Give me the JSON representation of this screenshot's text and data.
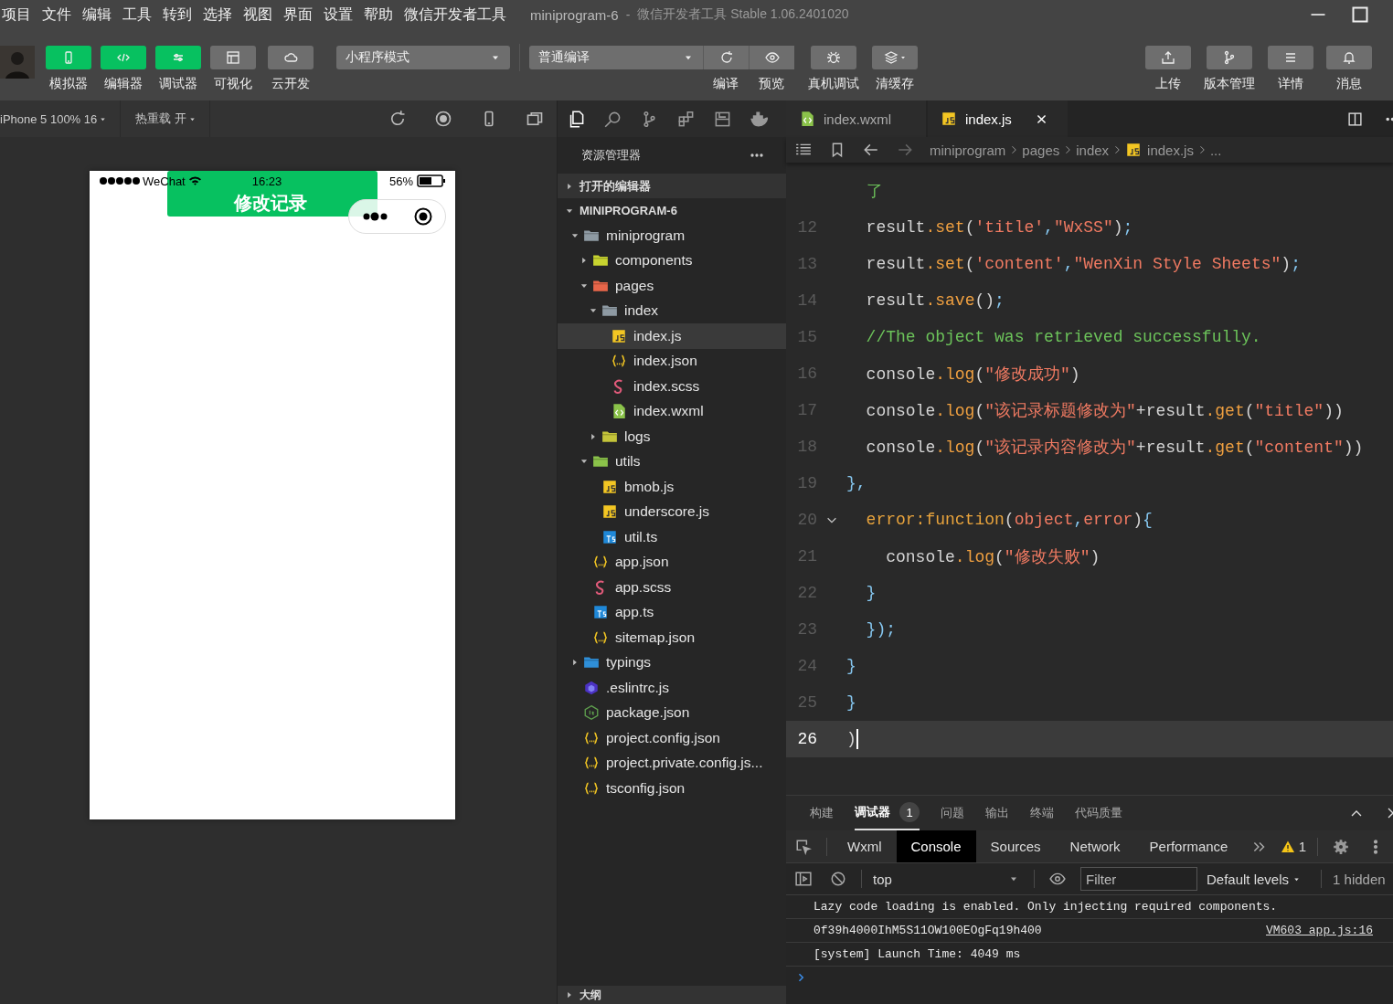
{
  "menu": [
    "项目",
    "文件",
    "编辑",
    "工具",
    "转到",
    "选择",
    "视图",
    "界面",
    "设置",
    "帮助",
    "微信开发者工具"
  ],
  "window": {
    "title": "miniprogram-6",
    "separator": "-",
    "subtitle": "微信开发者工具 Stable 1.06.2401020"
  },
  "toolbar": {
    "left_buttons": [
      {
        "label": "模拟器",
        "kind": "phone",
        "on": true
      },
      {
        "label": "编辑器",
        "kind": "code",
        "on": true
      },
      {
        "label": "调试器",
        "kind": "sliders",
        "on": true
      },
      {
        "label": "可视化",
        "kind": "layout",
        "on": false
      },
      {
        "label": "云开发",
        "kind": "cloud",
        "on": false
      }
    ],
    "mode_select": {
      "value": "小程序模式"
    },
    "compile_select": {
      "value": "普通编译"
    },
    "actions": [
      {
        "label": "编译",
        "kind": "refresh"
      },
      {
        "label": "预览",
        "kind": "eye"
      },
      {
        "label": "真机调试",
        "kind": "bug"
      },
      {
        "label": "清缓存",
        "kind": "layers"
      }
    ],
    "right_buttons": [
      {
        "label": "上传",
        "kind": "upload"
      },
      {
        "label": "版本管理",
        "kind": "branch"
      },
      {
        "label": "详情",
        "kind": "menu"
      },
      {
        "label": "消息",
        "kind": "bell"
      }
    ]
  },
  "simulator": {
    "device": "iPhone 5 100% 16",
    "hot_reload": "热重载 开",
    "status_bar": {
      "carrier": "WeChat",
      "time": "16:23",
      "battery": "56%"
    },
    "nav_title": "修改记录"
  },
  "explorer": {
    "title": "资源管理器",
    "sections": [
      {
        "label": "打开的编辑器",
        "expanded": false
      },
      {
        "label": "MINIPROGRAM-6",
        "expanded": true
      }
    ],
    "tree": [
      {
        "name": "miniprogram",
        "kind": "folder",
        "expanded": true,
        "selected": false,
        "children": [
          {
            "name": "components",
            "kind": "folder-components",
            "expanded": false,
            "selected": false
          },
          {
            "name": "pages",
            "kind": "folder-pages",
            "expanded": true,
            "selected": false,
            "children": [
              {
                "name": "index",
                "kind": "folder",
                "expanded": true,
                "selected": false,
                "children": [
                  {
                    "name": "index.js",
                    "kind": "js",
                    "selected": true
                  },
                  {
                    "name": "index.json",
                    "kind": "json",
                    "selected": false
                  },
                  {
                    "name": "index.scss",
                    "kind": "scss",
                    "selected": false
                  },
                  {
                    "name": "index.wxml",
                    "kind": "wxml",
                    "selected": false
                  }
                ]
              },
              {
                "name": "logs",
                "kind": "folder-logs",
                "expanded": false,
                "selected": false
              }
            ]
          },
          {
            "name": "utils",
            "kind": "folder-utils",
            "expanded": true,
            "selected": false,
            "children": [
              {
                "name": "bmob.js",
                "kind": "js",
                "selected": false
              },
              {
                "name": "underscore.js",
                "kind": "js",
                "selected": false
              },
              {
                "name": "util.ts",
                "kind": "ts",
                "selected": false
              }
            ]
          },
          {
            "name": "app.json",
            "kind": "json",
            "selected": false
          },
          {
            "name": "app.scss",
            "kind": "scss",
            "selected": false
          },
          {
            "name": "app.ts",
            "kind": "ts",
            "selected": false
          },
          {
            "name": "sitemap.json",
            "kind": "json",
            "selected": false
          }
        ]
      },
      {
        "name": "typings",
        "kind": "folder-typings",
        "expanded": false,
        "selected": false
      },
      {
        "name": ".eslintrc.js",
        "kind": "eslint",
        "selected": false
      },
      {
        "name": "package.json",
        "kind": "node",
        "selected": false
      },
      {
        "name": "project.config.json",
        "kind": "json",
        "selected": false
      },
      {
        "name": "project.private.config.js...",
        "kind": "json",
        "selected": false
      },
      {
        "name": "tsconfig.json",
        "kind": "json",
        "selected": false
      }
    ],
    "outline": {
      "label": "大纲",
      "expanded": false
    }
  },
  "editor": {
    "tabs": [
      {
        "label": "index.wxml",
        "kind": "wxml",
        "selected": false
      },
      {
        "label": "index.js",
        "kind": "js",
        "selected": true
      }
    ],
    "breadcrumb": [
      {
        "label": "miniprogram",
        "kind": "folder"
      },
      {
        "label": "pages",
        "kind": "folder"
      },
      {
        "label": "index",
        "kind": "folder"
      },
      {
        "label": "index.js",
        "kind": "js"
      },
      {
        "label": "...",
        "kind": "more"
      }
    ],
    "lines": [
      {
        "tokens": [
          {
            "kind": "comment",
            "text": "  了"
          }
        ]
      },
      {
        "number": "12",
        "tokens": [
          {
            "kind": "plain",
            "text": "  result"
          },
          {
            "kind": "method",
            "text": ".set"
          },
          {
            "kind": "plain",
            "text": "("
          },
          {
            "kind": "string",
            "text": "'title'"
          },
          {
            "kind": "punct",
            "text": ","
          },
          {
            "kind": "string",
            "text": "\"WxSS\""
          },
          {
            "kind": "plain",
            "text": ")"
          },
          {
            "kind": "punct",
            "text": ";"
          }
        ]
      },
      {
        "number": "13",
        "tokens": [
          {
            "kind": "plain",
            "text": "  result"
          },
          {
            "kind": "method",
            "text": ".set"
          },
          {
            "kind": "plain",
            "text": "("
          },
          {
            "kind": "string",
            "text": "'content'"
          },
          {
            "kind": "punct",
            "text": ","
          },
          {
            "kind": "string",
            "text": "\"WenXin Style Sheets\""
          },
          {
            "kind": "plain",
            "text": ")"
          },
          {
            "kind": "punct",
            "text": ";"
          }
        ]
      },
      {
        "number": "14",
        "tokens": [
          {
            "kind": "plain",
            "text": "  result"
          },
          {
            "kind": "method",
            "text": ".save"
          },
          {
            "kind": "plain",
            "text": "()"
          },
          {
            "kind": "punct",
            "text": ";"
          }
        ]
      },
      {
        "number": "15",
        "tokens": [
          {
            "kind": "comment",
            "text": "  //The object was retrieved successfully."
          }
        ]
      },
      {
        "number": "16",
        "tokens": [
          {
            "kind": "plain",
            "text": "  console"
          },
          {
            "kind": "method",
            "text": ".log"
          },
          {
            "kind": "plain",
            "text": "("
          },
          {
            "kind": "string",
            "text": "\"修改成功\""
          },
          {
            "kind": "plain",
            "text": ")"
          }
        ]
      },
      {
        "number": "17",
        "tokens": [
          {
            "kind": "plain",
            "text": "  console"
          },
          {
            "kind": "method",
            "text": ".log"
          },
          {
            "kind": "plain",
            "text": "("
          },
          {
            "kind": "string",
            "text": "\"该记录标题修改为\""
          },
          {
            "kind": "plain",
            "text": "+result"
          },
          {
            "kind": "method",
            "text": ".get"
          },
          {
            "kind": "plain",
            "text": "("
          },
          {
            "kind": "string",
            "text": "\"title\""
          },
          {
            "kind": "plain",
            "text": "))"
          }
        ]
      },
      {
        "number": "18",
        "tokens": [
          {
            "kind": "plain",
            "text": "  console"
          },
          {
            "kind": "method",
            "text": ".log"
          },
          {
            "kind": "plain",
            "text": "("
          },
          {
            "kind": "string",
            "text": "\"该记录内容修改为\""
          },
          {
            "kind": "plain",
            "text": "+result"
          },
          {
            "kind": "method",
            "text": ".get"
          },
          {
            "kind": "plain",
            "text": "("
          },
          {
            "kind": "string",
            "text": "\"content\""
          },
          {
            "kind": "plain",
            "text": "))"
          }
        ]
      },
      {
        "number": "19",
        "tokens": [
          {
            "kind": "punct",
            "text": "},"
          }
        ]
      },
      {
        "number": "20",
        "foldable": true,
        "tokens": [
          {
            "kind": "keyword",
            "text": "  error:function"
          },
          {
            "kind": "plain",
            "text": "("
          },
          {
            "kind": "param",
            "text": "object"
          },
          {
            "kind": "punct",
            "text": ","
          },
          {
            "kind": "param",
            "text": "error"
          },
          {
            "kind": "plain",
            "text": ")"
          },
          {
            "kind": "punct",
            "text": "{"
          }
        ]
      },
      {
        "number": "21",
        "tokens": [
          {
            "kind": "plain",
            "text": "    console"
          },
          {
            "kind": "method",
            "text": ".log"
          },
          {
            "kind": "plain",
            "text": "("
          },
          {
            "kind": "string",
            "text": "\"修改失败\""
          },
          {
            "kind": "plain",
            "text": ")"
          }
        ]
      },
      {
        "number": "22",
        "tokens": [
          {
            "kind": "punct",
            "text": "  }"
          }
        ]
      },
      {
        "number": "23",
        "tokens": [
          {
            "kind": "punct",
            "text": "  });"
          }
        ]
      },
      {
        "number": "24",
        "tokens": [
          {
            "kind": "punct",
            "text": "}"
          }
        ]
      },
      {
        "number": "25",
        "tokens": [
          {
            "kind": "punct",
            "text": "}"
          }
        ]
      },
      {
        "number": "26",
        "current": true,
        "tokens": [
          {
            "kind": "plain",
            "text": ")"
          }
        ]
      }
    ]
  },
  "panel": {
    "tabs": [
      {
        "label": "构建",
        "selected": false
      },
      {
        "label": "调试器",
        "selected": true,
        "badge": "1"
      },
      {
        "label": "问题",
        "selected": false
      },
      {
        "label": "输出",
        "selected": false
      },
      {
        "label": "终端",
        "selected": false
      },
      {
        "label": "代码质量",
        "selected": false
      }
    ],
    "devtools_tabs": [
      {
        "label": "Wxml",
        "selected": false
      },
      {
        "label": "Console",
        "selected": true
      },
      {
        "label": "Sources",
        "selected": false
      },
      {
        "label": "Network",
        "selected": false
      },
      {
        "label": "Performance",
        "selected": false
      }
    ],
    "warnings": "1",
    "context": "top",
    "filter": {
      "placeholder": "Filter"
    },
    "levels": "Default levels",
    "hidden": "1 hidden",
    "messages": [
      {
        "text": "Lazy code loading is enabled. Only injecting required components."
      },
      {
        "text": "0f39h4000IhM5S11OW100EOgFq19h400",
        "source": "VM603 app.js:16"
      },
      {
        "text": "[system] Launch Time: 4049 ms"
      }
    ]
  }
}
